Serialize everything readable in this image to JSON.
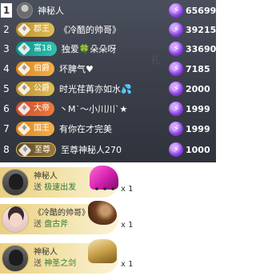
{
  "ranking": {
    "rows": [
      {
        "rank": "1",
        "badge": "",
        "name": "神秘人",
        "score": "65699"
      },
      {
        "rank": "2",
        "badge": "郡王",
        "name": "《冷酷的帅哥》",
        "score": "39215"
      },
      {
        "rank": "3",
        "badge": "富18",
        "name": "独爱🍀朵朵呀",
        "score": "33690"
      },
      {
        "rank": "4",
        "badge": "伯爵",
        "name": "坏脾气♥",
        "score": "7185"
      },
      {
        "rank": "5",
        "badge": "公爵",
        "name": "时光荏苒亦如水💦",
        "score": "2000"
      },
      {
        "rank": "6",
        "badge": "大帝",
        "name": "丶M˙〜小川川ˋ★",
        "score": "1999"
      },
      {
        "rank": "7",
        "badge": "国王",
        "name": "有你在才完美",
        "score": "1999"
      },
      {
        "rank": "8",
        "badge": "至尊",
        "name": "至尊神秘人270",
        "score": "1000"
      }
    ]
  },
  "gifts": [
    {
      "sender": "神秘人",
      "action": "送",
      "gift": "极速出发",
      "count": "x 1",
      "visual": "pink-sports-car"
    },
    {
      "sender": "《冷酷的帅哥》",
      "action": "送",
      "gift": "盘古斧",
      "count": "x 1",
      "visual": "pangu-axe"
    },
    {
      "sender": "神秘人",
      "action": "送",
      "gift": "神圣之剑",
      "count": "x 1",
      "visual": "holy-sword"
    }
  ],
  "colors": {
    "panel_bg": "#3b3f4a",
    "gift_card": "#f1df9f",
    "gem": "#8a3fe0"
  }
}
